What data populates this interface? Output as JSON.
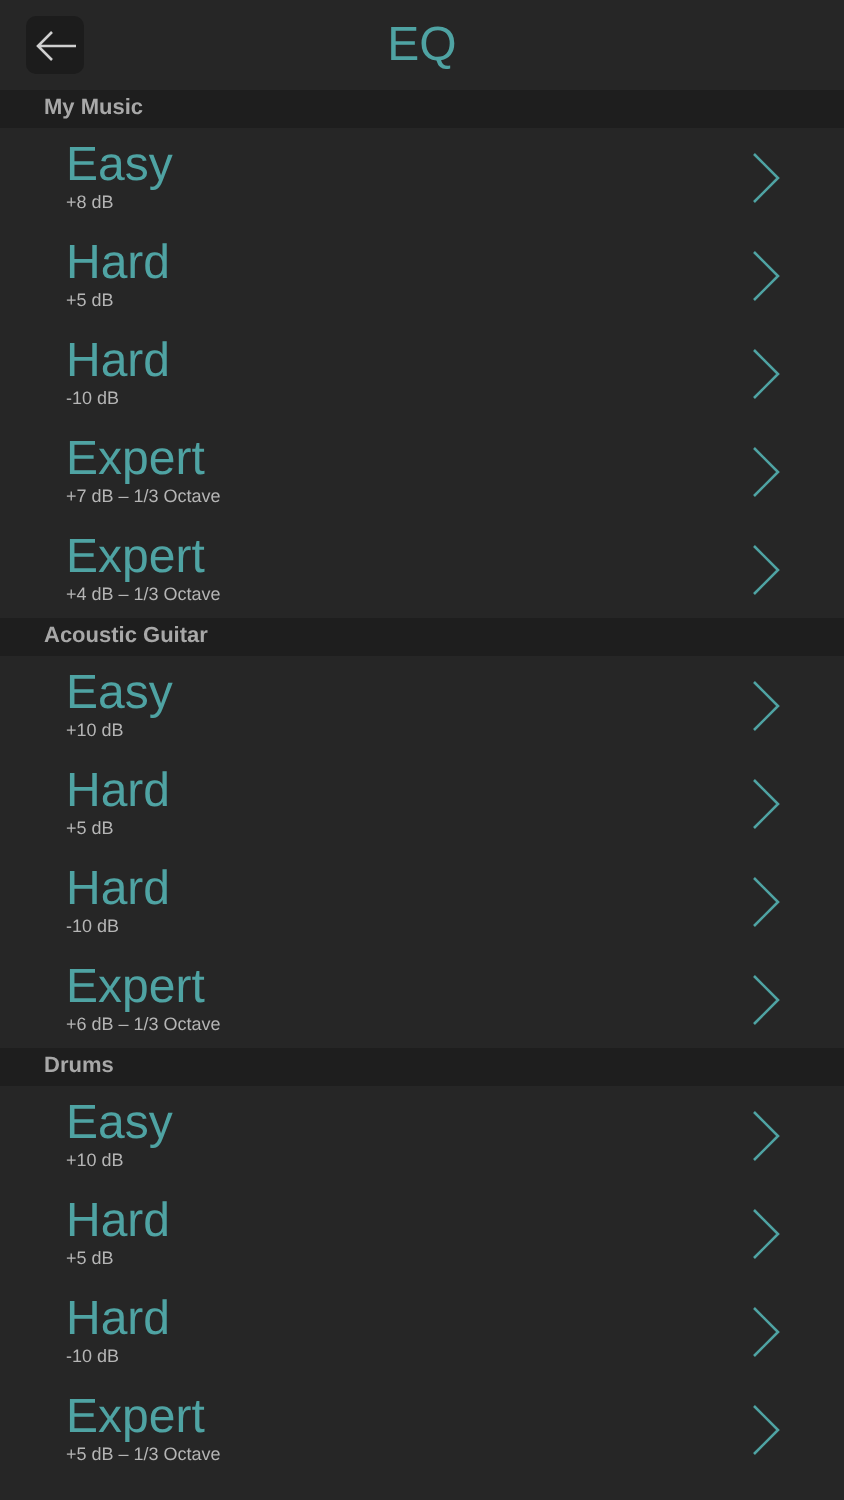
{
  "header": {
    "title": "EQ"
  },
  "sections": [
    {
      "title": "My Music",
      "items": [
        {
          "title": "Easy",
          "subtitle": "+8 dB"
        },
        {
          "title": "Hard",
          "subtitle": "+5 dB"
        },
        {
          "title": "Hard",
          "subtitle": "-10 dB"
        },
        {
          "title": "Expert",
          "subtitle": "+7 dB – 1/3 Octave"
        },
        {
          "title": "Expert",
          "subtitle": "+4 dB – 1/3 Octave"
        }
      ]
    },
    {
      "title": "Acoustic Guitar",
      "items": [
        {
          "title": "Easy",
          "subtitle": "+10 dB"
        },
        {
          "title": "Hard",
          "subtitle": "+5 dB"
        },
        {
          "title": "Hard",
          "subtitle": "-10 dB"
        },
        {
          "title": "Expert",
          "subtitle": "+6 dB – 1/3 Octave"
        }
      ]
    },
    {
      "title": "Drums",
      "items": [
        {
          "title": "Easy",
          "subtitle": "+10 dB"
        },
        {
          "title": "Hard",
          "subtitle": "+5 dB"
        },
        {
          "title": "Hard",
          "subtitle": "-10 dB"
        },
        {
          "title": "Expert",
          "subtitle": "+5 dB – 1/3 Octave"
        }
      ]
    }
  ]
}
